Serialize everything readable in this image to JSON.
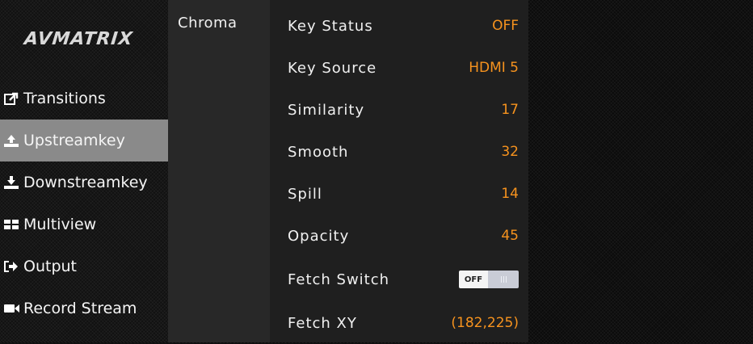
{
  "brand": {
    "logo_text": "AVMATRIX"
  },
  "sidebar": {
    "items": [
      {
        "label": "Transitions",
        "icon": "share-icon",
        "active": false
      },
      {
        "label": "Upstreamkey",
        "icon": "upload-icon",
        "active": true
      },
      {
        "label": "Downstreamkey",
        "icon": "download-icon",
        "active": false
      },
      {
        "label": "Multiview",
        "icon": "grid-icon",
        "active": false
      },
      {
        "label": "Output",
        "icon": "sign-out-icon",
        "active": false
      },
      {
        "label": "Record Stream",
        "icon": "video-camera-icon",
        "active": false
      }
    ]
  },
  "submenu": {
    "category": "Chroma"
  },
  "settings": [
    {
      "label": "Key Status",
      "value": "OFF"
    },
    {
      "label": "Key Source",
      "value": "HDMI 5"
    },
    {
      "label": "Similarity",
      "value": "17"
    },
    {
      "label": "Smooth",
      "value": "32"
    },
    {
      "label": "Spill",
      "value": "14"
    },
    {
      "label": "Opacity",
      "value": "45"
    },
    {
      "label": "Fetch Switch",
      "toggle_label": "OFF",
      "toggle_on": false
    },
    {
      "label": "Fetch XY",
      "value": "(182,225)"
    }
  ],
  "colors": {
    "accent": "#f7931e",
    "active_nav_bg": "#8a8a8a",
    "panel_bg": "#1f1f1f",
    "label_column_bg": "#282828"
  }
}
